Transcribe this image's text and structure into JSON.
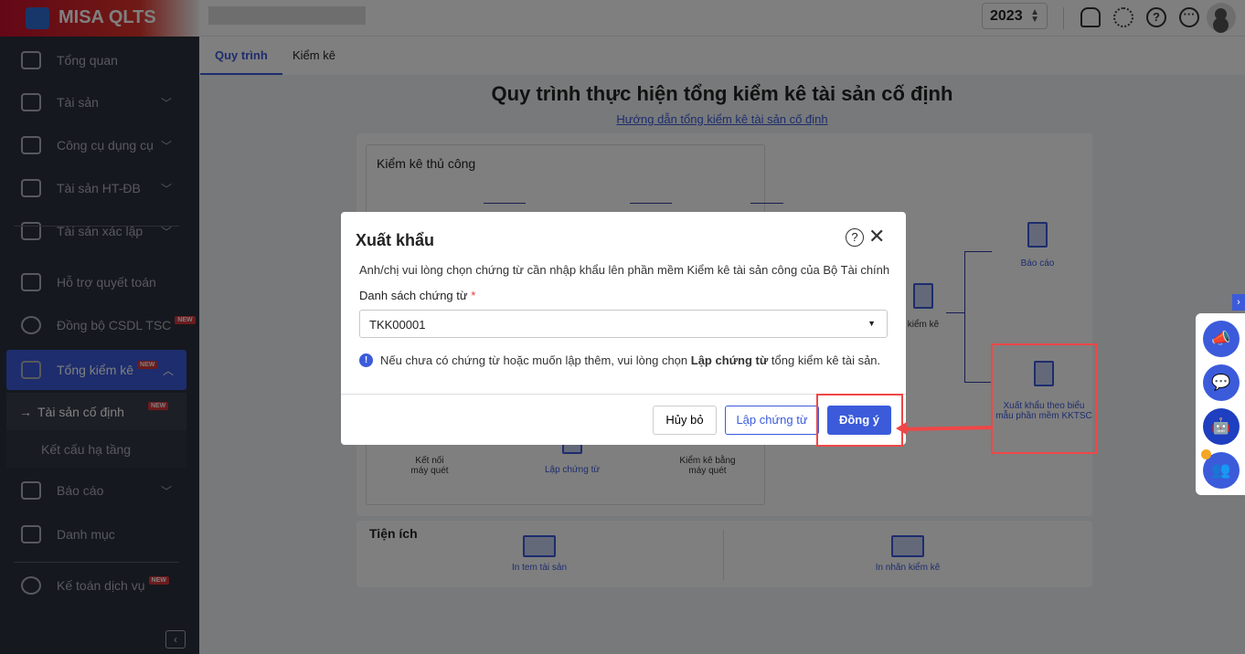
{
  "app": {
    "name": "MISA QLTS",
    "year": "2023"
  },
  "topbar": {
    "icons": [
      "bell-icon",
      "gear-icon",
      "help-icon",
      "more-icon",
      "avatar"
    ]
  },
  "sidebar": {
    "items": [
      {
        "label": "Tổng quan"
      },
      {
        "label": "Tài sản"
      },
      {
        "label": "Công cụ dụng cụ"
      },
      {
        "label": "Tài sản HT-ĐB"
      },
      {
        "label": "Tài sản xác lập"
      },
      {
        "label": "Hỗ trợ quyết toán"
      },
      {
        "label": "Đồng bộ CSDL TSC",
        "badge": "NEW"
      },
      {
        "label": "Tổng kiểm kê",
        "badge": "NEW"
      },
      {
        "label": "Báo cáo"
      },
      {
        "label": "Danh mục"
      },
      {
        "label": "Kế toán dịch vụ",
        "badge": "NEW"
      }
    ],
    "sub": [
      {
        "label": "Tài sản cố định",
        "badge": "NEW",
        "arrow": "→"
      },
      {
        "label": "Kết cấu hạ tầng"
      }
    ]
  },
  "tabs": [
    {
      "label": "Quy trình"
    },
    {
      "label": "Kiểm kê"
    }
  ],
  "main": {
    "title": "Quy trình thực hiện tổng kiểm kê tài sản cố định",
    "guide_link": "Hướng dẫn tổng kiểm kê tài sản cố định",
    "manual_title": "Kiểm kê thủ công",
    "nodes": {
      "connect": "Kết nối máy quét",
      "create": "Lập chứng từ",
      "scan": "Kiểm kê bằng máy quét",
      "kiemke": "kiểm kê",
      "report": "Báo cáo",
      "export": "Xuất khẩu theo biểu mẫu phần mềm KKTSC"
    },
    "utilities_title": "Tiện ích",
    "print_tag": "In tem tài sản",
    "print_label": "In nhãn kiểm kê"
  },
  "dialog": {
    "title": "Xuất khẩu",
    "description": "Anh/chị vui lòng chọn chứng từ cần nhập khẩu lên phần mềm Kiểm kê tài sản công của Bộ Tài chính",
    "field_label": "Danh sách chứng từ",
    "required": "*",
    "selected": "TKK00001",
    "info_pre": "Nếu chưa có chứng từ hoặc muốn lập thêm, vui lòng chọn ",
    "info_bold": "Lập chứng từ",
    "info_post": " tổng kiểm kê tài sản.",
    "cancel": "Hủy bỏ",
    "create": "Lập chứng từ",
    "ok": "Đồng ý"
  },
  "colors": {
    "accent": "#3b5bdb",
    "highlight": "#f04646"
  }
}
